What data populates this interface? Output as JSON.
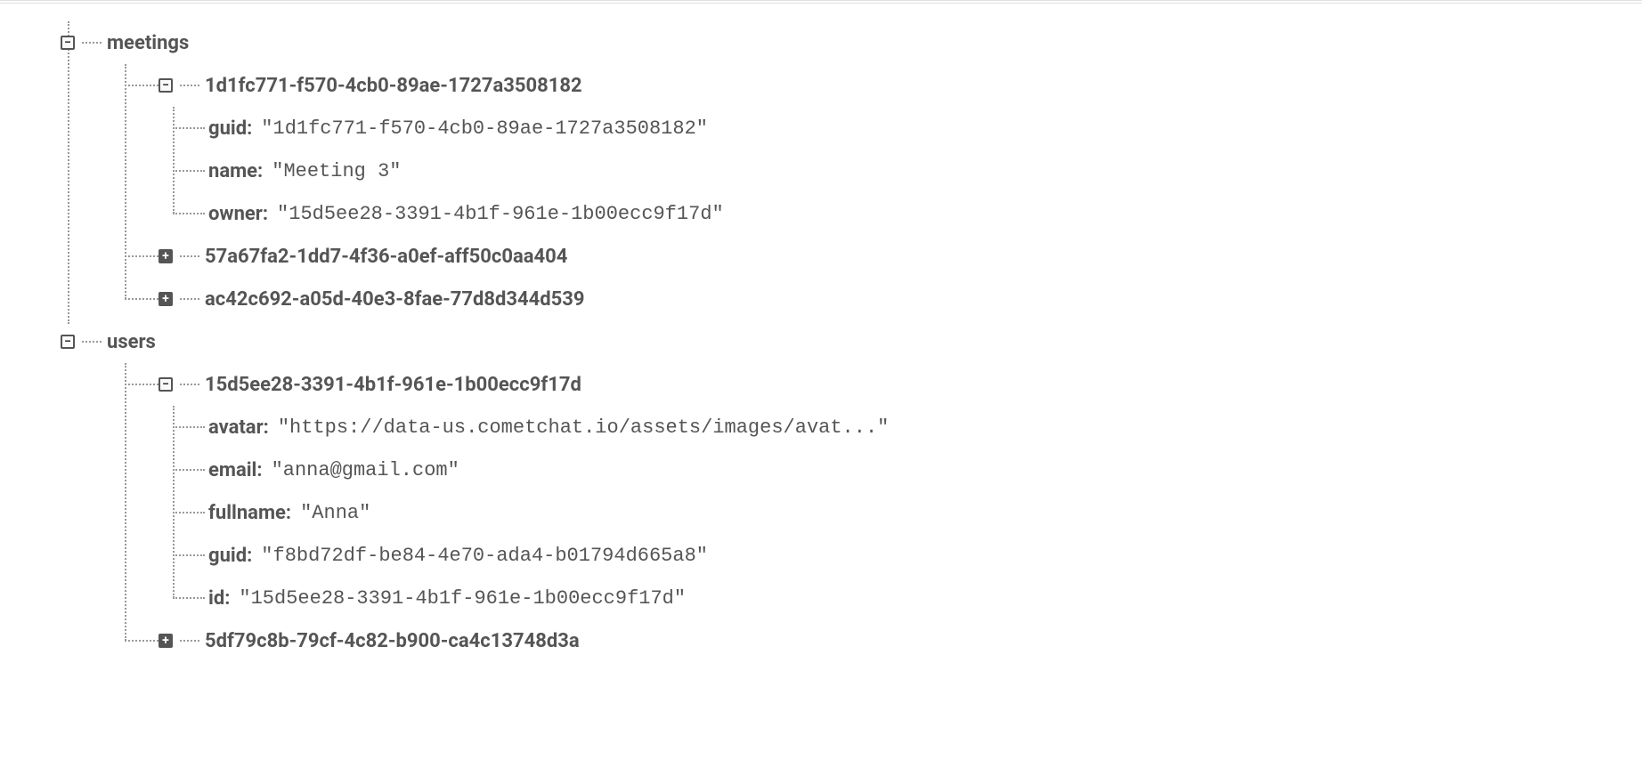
{
  "tree": {
    "meetings": {
      "label": "meetings",
      "expanded": true,
      "items": [
        {
          "id": "1d1fc771-f570-4cb0-89ae-1727a3508182",
          "expanded": true,
          "fields": {
            "guid": {
              "key": "guid:",
              "value": "\"1d1fc771-f570-4cb0-89ae-1727a3508182\""
            },
            "name": {
              "key": "name:",
              "value": "\"Meeting 3\""
            },
            "owner": {
              "key": "owner:",
              "value": "\"15d5ee28-3391-4b1f-961e-1b00ecc9f17d\""
            }
          }
        },
        {
          "id": "57a67fa2-1dd7-4f36-a0ef-aff50c0aa404",
          "expanded": false
        },
        {
          "id": "ac42c692-a05d-40e3-8fae-77d8d344d539",
          "expanded": false
        }
      ]
    },
    "users": {
      "label": "users",
      "expanded": true,
      "items": [
        {
          "id": "15d5ee28-3391-4b1f-961e-1b00ecc9f17d",
          "expanded": true,
          "fields": {
            "avatar": {
              "key": "avatar:",
              "value": "\"https://data-us.cometchat.io/assets/images/avat...\""
            },
            "email": {
              "key": "email:",
              "value": "\"anna@gmail.com\""
            },
            "fullname": {
              "key": "fullname:",
              "value": "\"Anna\""
            },
            "guid": {
              "key": "guid:",
              "value": "\"f8bd72df-be84-4e70-ada4-b01794d665a8\""
            },
            "id": {
              "key": "id:",
              "value": "\"15d5ee28-3391-4b1f-961e-1b00ecc9f17d\""
            }
          }
        },
        {
          "id": "5df79c8b-79cf-4c82-b900-ca4c13748d3a",
          "expanded": false
        }
      ]
    }
  }
}
